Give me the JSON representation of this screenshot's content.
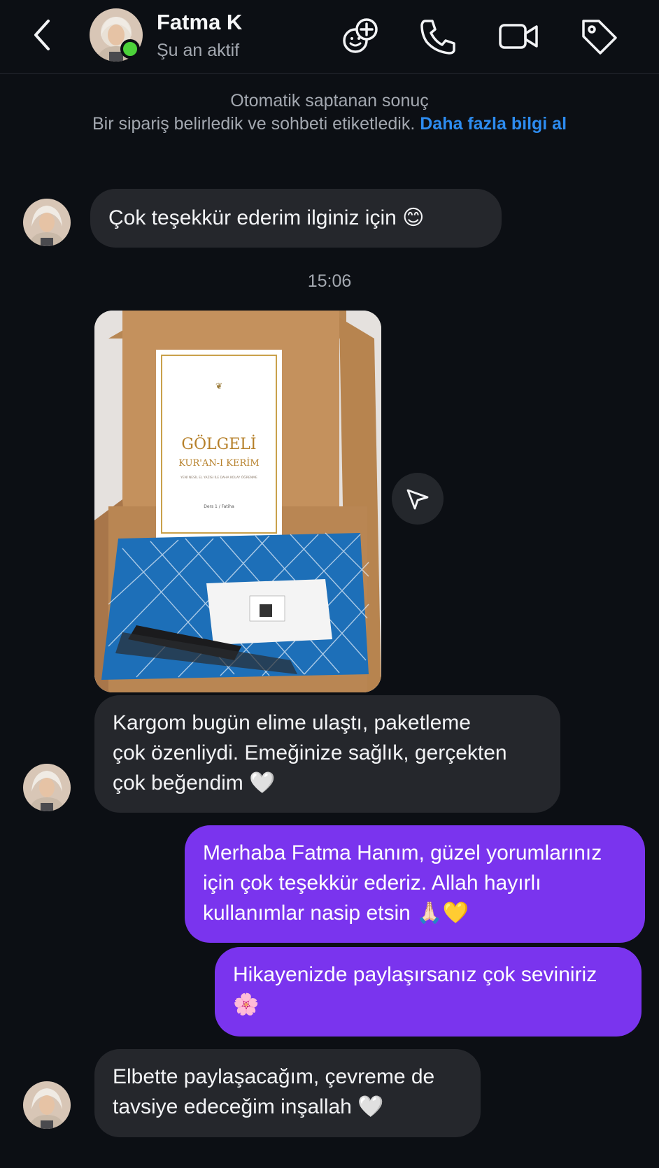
{
  "header": {
    "contact_name": "Fatma K",
    "status": "Şu an aktif",
    "online_color": "#4cd23a",
    "icons": [
      "back-icon",
      "add-participant-icon",
      "phone-icon",
      "video-icon",
      "tag-icon"
    ]
  },
  "notice": {
    "title": "Otomatik saptanan sonuç",
    "body": "Bir sipariş belirledik ve sohbeti etiketledik.",
    "link": "Daha fazla bilgi al"
  },
  "messages": [
    {
      "from": "contact",
      "text": "Çok teşekkür ederim ilginiz için",
      "emoji": "😊"
    },
    {
      "timestamp": "15:06"
    },
    {
      "from": "contact",
      "type": "photo",
      "photo_text": {
        "title": "GÖLGELİ",
        "subtitle": "KUR'AN-I KERİM",
        "tagline": "YENİ NESİL EL YAZISI İLE DAHA KOLAY ÖĞRENME",
        "lesson": "Ders 1 / Fatiha"
      }
    },
    {
      "from": "contact",
      "lines": [
        "Kargom bugün elime ulaştı, paketleme",
        "çok özenliydi. Emeğinize sağlık, gerçekten",
        "çok beğendim"
      ],
      "emoji": "🤍"
    },
    {
      "from": "me",
      "lines": [
        "Merhaba Fatma Hanım, güzel yorumlarınız",
        "için çok teşekkür ederiz. Allah hayırlı",
        "kullanımlar nasip etsin"
      ],
      "emoji": "🙏🏻💛"
    },
    {
      "from": "me",
      "lines": [
        "Hikayenizde paylaşırsanız çok seviniriz"
      ],
      "emoji": "🌸"
    },
    {
      "from": "contact",
      "lines": [
        "Elbette paylaşacağım, çevreme de",
        "tavsiye edeceğim inşallah"
      ],
      "emoji": "🤍"
    }
  ],
  "colors": {
    "background": "#0c0f14",
    "incoming_bubble": "#25272c",
    "outgoing_bubble": "#7a34ee",
    "link": "#2d8cf0"
  }
}
